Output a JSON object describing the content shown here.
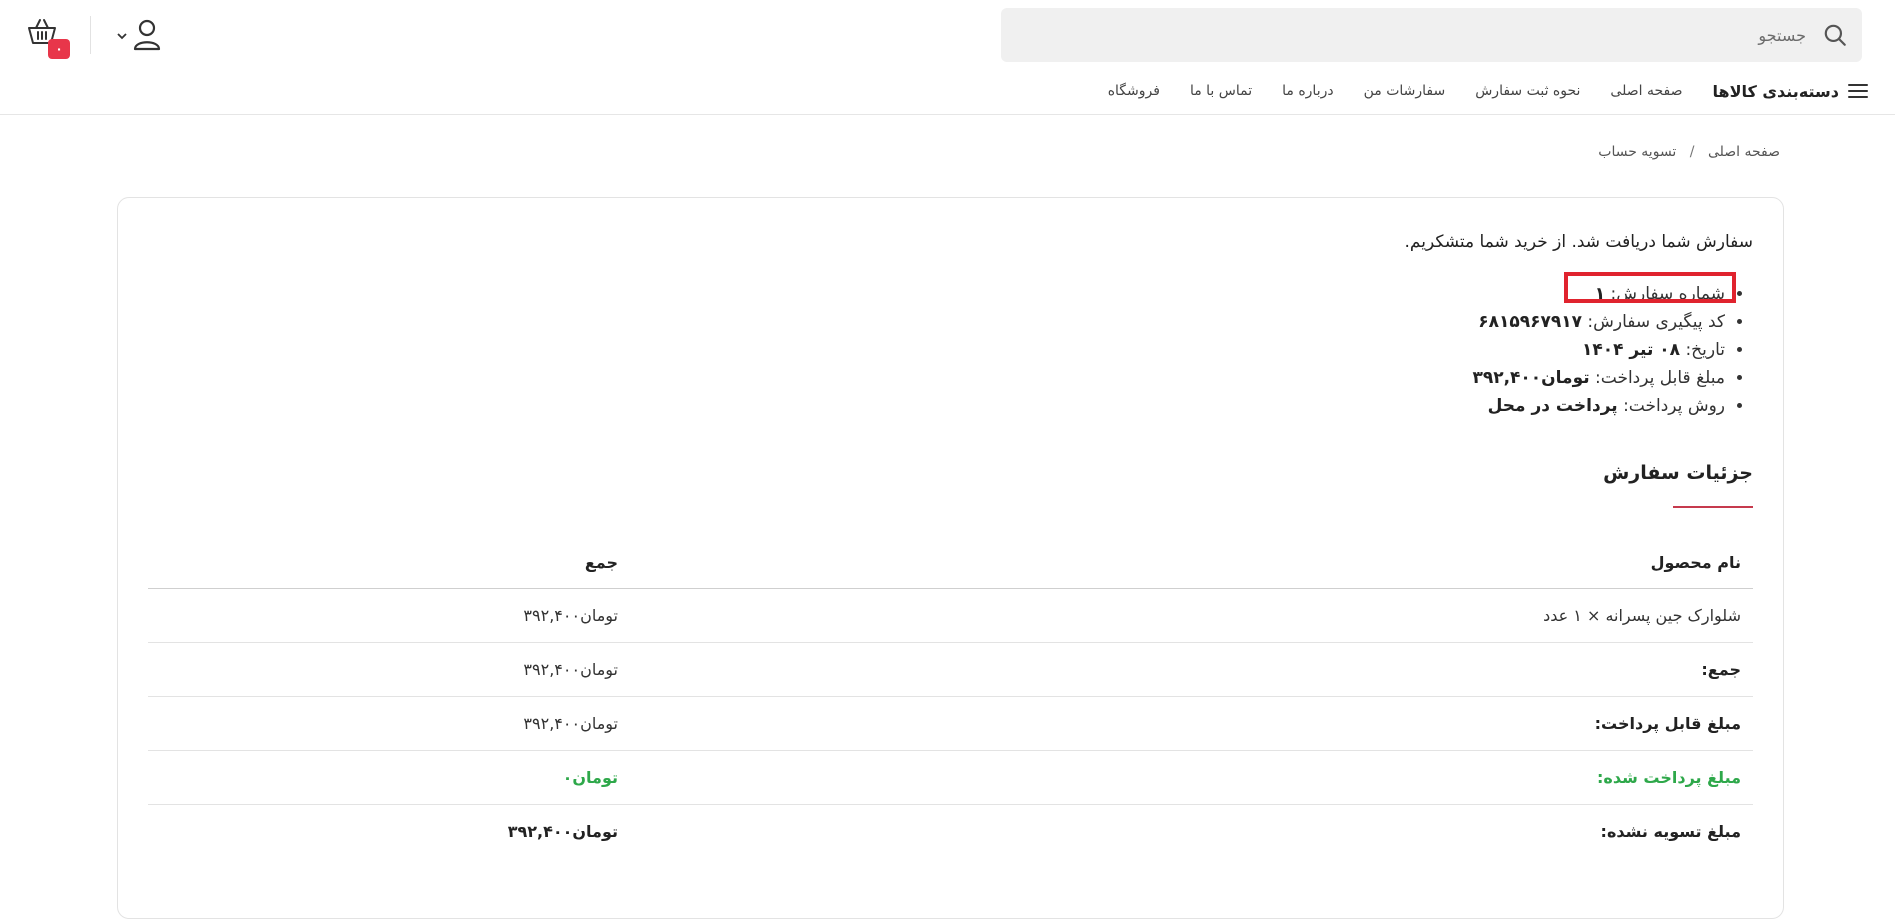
{
  "header": {
    "search_placeholder": "جستجو",
    "cart_count": "۰",
    "nav": {
      "category_label": "دسته‌بندی کالاها",
      "links": [
        "صفحه اصلی",
        "نحوه ثبت سفارش",
        "سفارشات من",
        "درباره ما",
        "تماس با ما",
        "فروشگاه"
      ]
    }
  },
  "breadcrumb": {
    "home": "صفحه اصلی",
    "separator": "/",
    "current": "تسویه حساب"
  },
  "order": {
    "thanks_message": "سفارش شما دریافت شد. از خرید شما متشکریم.",
    "number_label": "شماره سفارش:",
    "number_value": "۱",
    "tracking_label": "کد پیگیری سفارش:",
    "tracking_value": "۶۸۱۵۹۶۷۹۱۷",
    "date_label": "تاریخ:",
    "date_value": "۰۸ تیر ۱۴۰۴",
    "payable_label": "مبلغ قابل پرداخت:",
    "payable_value": "تومان۳۹۲,۴۰۰",
    "method_label": "روش پرداخت:",
    "method_value": "پرداخت در محل"
  },
  "details": {
    "title": "جزئیات سفارش",
    "columns": {
      "name": "نام محصول",
      "total": "جمع"
    },
    "rows": [
      {
        "name": "شلوارک جین پسرانه × ۱ عدد",
        "total": "تومان۳۹۲,۴۰۰"
      },
      {
        "name": "جمع:",
        "total": "تومان۳۹۲,۴۰۰"
      },
      {
        "name": "مبلغ قابل پرداخت:",
        "total": "تومان۳۹۲,۴۰۰"
      },
      {
        "name": "مبلغ پرداخت شده:",
        "total": "تومان۰"
      },
      {
        "name": "مبلغ تسویه نشده:",
        "total": "تومان۳۹۲,۴۰۰"
      }
    ]
  },
  "colors": {
    "accent": "#e8364a",
    "highlight": "#e0232e",
    "success": "#2ea84a",
    "underline": "#c63a4d"
  }
}
